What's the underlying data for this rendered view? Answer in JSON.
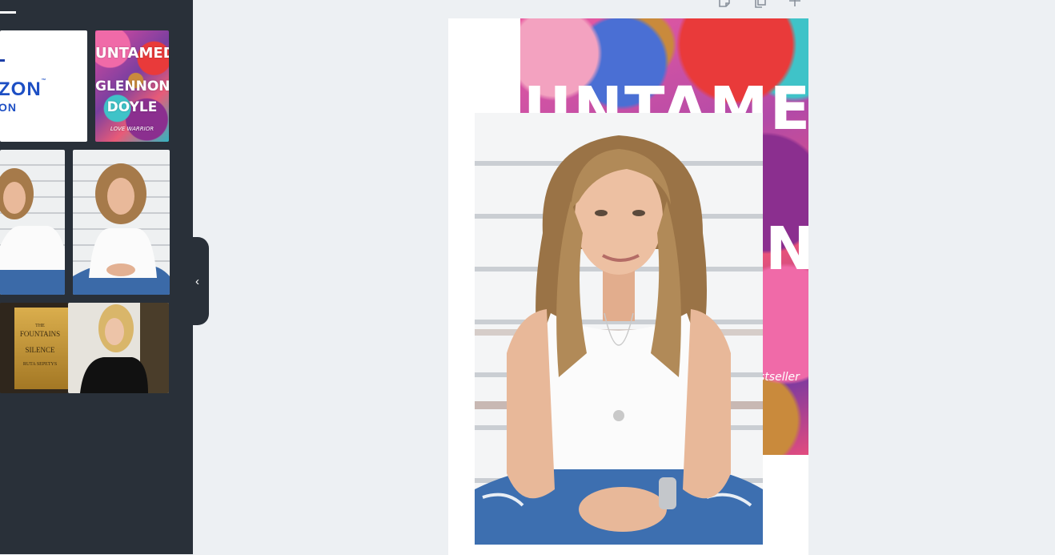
{
  "sidebar": {
    "thumbnails": {
      "horizon": {
        "main": "ZON",
        "sub": "ON",
        "tm": "™"
      },
      "untamed": {
        "title": "UNTAMED",
        "line1": "GLENNON",
        "line2": "DOYLE",
        "tagline": "LOVE WARRIOR"
      },
      "fountains": {
        "line1": "THE",
        "line2": "FOUNTAINS",
        "line3": "SILENCE",
        "author": "RUTA SEPETYS"
      }
    },
    "collapse_icon": "‹"
  },
  "toolbar": {
    "icons": [
      "notes-icon",
      "duplicate-page-icon",
      "add-page-icon"
    ]
  },
  "canvas": {
    "cover_title": "UNTAMED",
    "cover_letter": "N",
    "cover_tag": "stseller"
  },
  "colors": {
    "sidebar": "#293039",
    "workspace": "#edf0f3",
    "horizon_blue": "#1d4fc4"
  }
}
